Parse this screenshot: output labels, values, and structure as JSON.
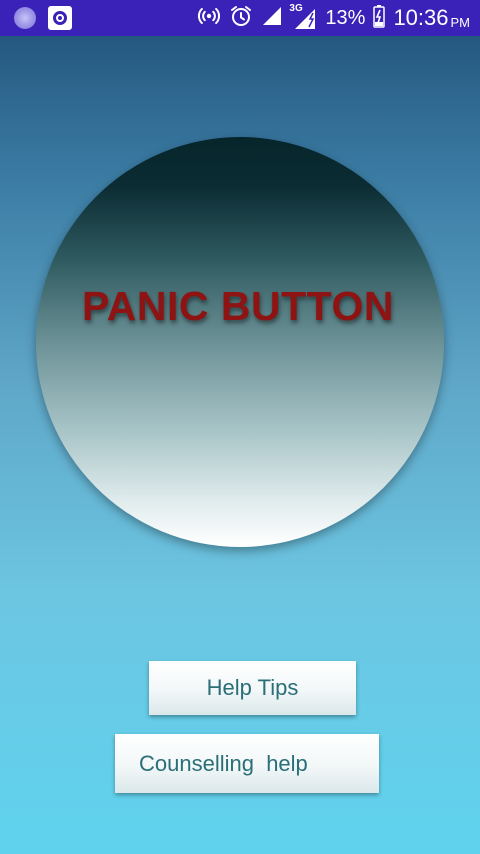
{
  "status_bar": {
    "battery_percent": "13%",
    "time": "10:36",
    "ampm": "PM",
    "network_label": "3G",
    "icons": [
      "notification-dot-icon",
      "target-icon",
      "hotspot-icon",
      "alarm-icon",
      "signal-icon",
      "signal-3g-icon",
      "battery-charging-icon"
    ],
    "bar_color": "#3a22b8"
  },
  "main": {
    "panic_label": "PANIC BUTTON",
    "help_tips_label": "Help Tips",
    "counselling_label": "Counselling  help"
  },
  "colors": {
    "panic_text": "#8e1313",
    "button_text": "#2a6f78"
  }
}
